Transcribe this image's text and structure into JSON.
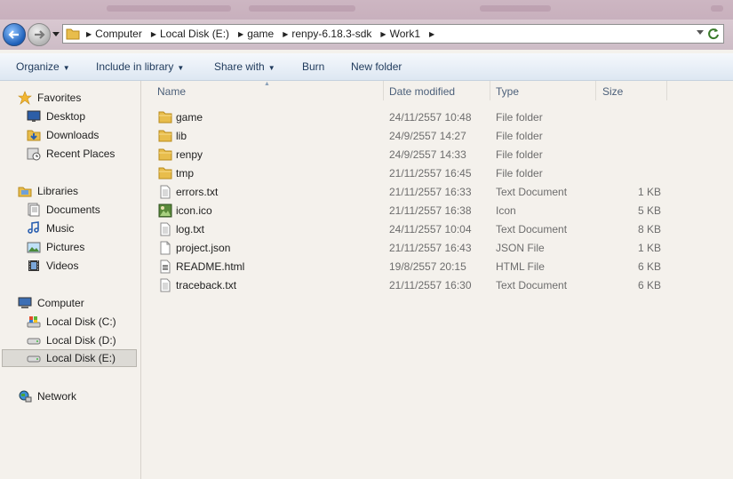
{
  "address": {
    "crumbs": [
      "Computer",
      "Local Disk (E:)",
      "game",
      "renpy-6.18.3-sdk",
      "Work1"
    ]
  },
  "toolbar": {
    "organize": "Organize",
    "include_in_library": "Include in library",
    "share_with": "Share with",
    "burn": "Burn",
    "new_folder": "New folder"
  },
  "nav": {
    "favorites": {
      "label": "Favorites",
      "items": [
        "Desktop",
        "Downloads",
        "Recent Places"
      ]
    },
    "libraries": {
      "label": "Libraries",
      "items": [
        "Documents",
        "Music",
        "Pictures",
        "Videos"
      ]
    },
    "computer": {
      "label": "Computer",
      "items": [
        "Local Disk (C:)",
        "Local Disk (D:)",
        "Local Disk (E:)"
      ]
    },
    "network": {
      "label": "Network"
    }
  },
  "columns": {
    "name": "Name",
    "date_modified": "Date modified",
    "type": "Type",
    "size": "Size"
  },
  "files": [
    {
      "name": "game",
      "date": "24/11/2557 10:48",
      "type": "File folder",
      "size": "",
      "icon": "folder-icon"
    },
    {
      "name": "lib",
      "date": "24/9/2557 14:27",
      "type": "File folder",
      "size": "",
      "icon": "folder-icon"
    },
    {
      "name": "renpy",
      "date": "24/9/2557 14:33",
      "type": "File folder",
      "size": "",
      "icon": "folder-icon"
    },
    {
      "name": "tmp",
      "date": "21/11/2557 16:45",
      "type": "File folder",
      "size": "",
      "icon": "folder-icon"
    },
    {
      "name": "errors.txt",
      "date": "21/11/2557 16:33",
      "type": "Text Document",
      "size": "1 KB",
      "icon": "text-file-icon"
    },
    {
      "name": "icon.ico",
      "date": "21/11/2557 16:38",
      "type": "Icon",
      "size": "5 KB",
      "icon": "image-file-icon"
    },
    {
      "name": "log.txt",
      "date": "24/11/2557 10:04",
      "type": "Text Document",
      "size": "8 KB",
      "icon": "text-file-icon"
    },
    {
      "name": "project.json",
      "date": "21/11/2557 16:43",
      "type": "JSON File",
      "size": "1 KB",
      "icon": "file-icon"
    },
    {
      "name": "README.html",
      "date": "19/8/2557 20:15",
      "type": "HTML File",
      "size": "6 KB",
      "icon": "html-file-icon"
    },
    {
      "name": "traceback.txt",
      "date": "21/11/2557 16:30",
      "type": "Text Document",
      "size": "6 KB",
      "icon": "text-file-icon"
    }
  ]
}
